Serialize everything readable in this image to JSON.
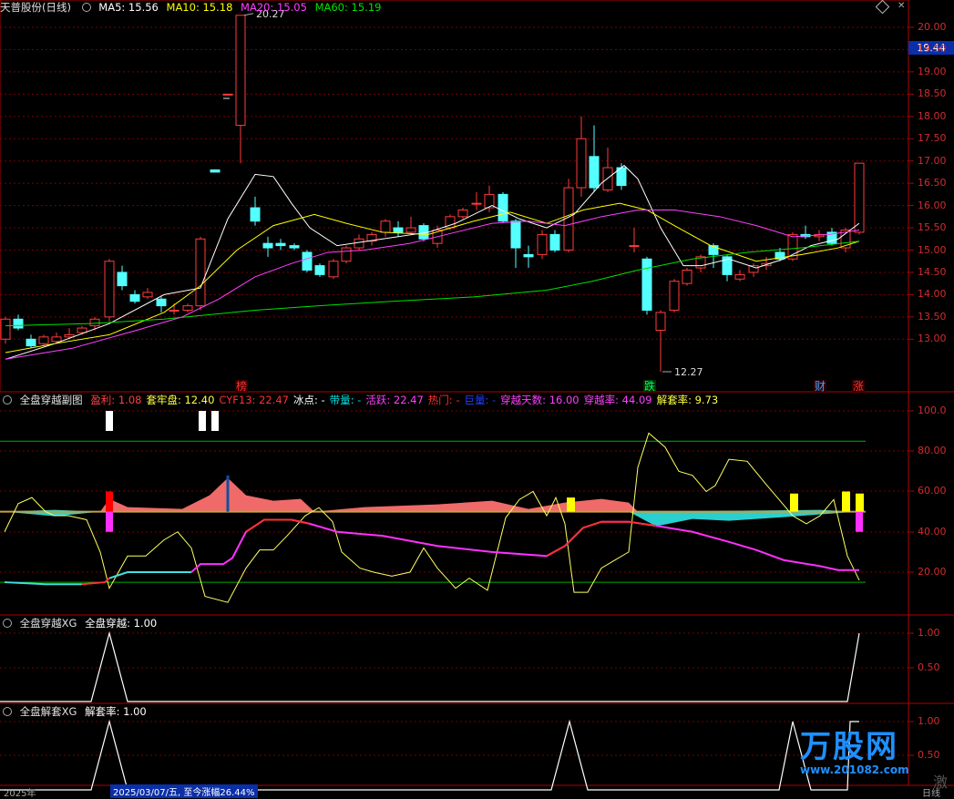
{
  "header_main": {
    "stock": "天普股份(日线)",
    "ma5": "MA5: 15.56",
    "ma10": "MA10: 15.18",
    "ma20": "MA20: 15.05",
    "ma60": "MA60: 15.19"
  },
  "header_sub": {
    "name": "全盘穿越副图",
    "items": [
      {
        "text": "盈利: 1.08",
        "color": "#ff4040"
      },
      {
        "text": "套牢盘: 12.40",
        "color": "#ffff40"
      },
      {
        "text": "CYF13: 22.47",
        "color": "#ff3030"
      },
      {
        "text": "冰点: -",
        "color": "#ffffff"
      },
      {
        "text": "带量: -",
        "color": "#00e5e5"
      },
      {
        "text": "活跃: 22.47",
        "color": "#ff40ff"
      },
      {
        "text": "热门: -",
        "color": "#ff3030"
      },
      {
        "text": "巨量: -",
        "color": "#2040ff"
      },
      {
        "text": "穿越天数: 16.00",
        "color": "#ff40ff"
      },
      {
        "text": "穿越率: 44.09",
        "color": "#ff40ff"
      },
      {
        "text": "解套率: 9.73",
        "color": "#ffff40"
      }
    ]
  },
  "header_xg1": {
    "name": "全盘穿越XG",
    "label": "全盘穿越: 1.00"
  },
  "header_xg2": {
    "name": "全盘解套XG",
    "label": "解套率: 1.00"
  },
  "price_axis": [
    "20.00",
    "19.50",
    "19.00",
    "18.50",
    "18.00",
    "17.50",
    "17.00",
    "16.50",
    "16.00",
    "15.50",
    "15.00",
    "14.50",
    "14.00",
    "13.50",
    "13.00"
  ],
  "current_price": "19.44",
  "sub_axis": [
    "100.0",
    "80.00",
    "60.00",
    "40.00",
    "20.00"
  ],
  "xg_axis": [
    "1.00",
    "0.50"
  ],
  "annotations": {
    "high": "20.27",
    "low": "12.27"
  },
  "tags": [
    {
      "text": "榜",
      "color": "#ff3030"
    },
    {
      "text": "跌",
      "color": "#00ff60"
    },
    {
      "text": "财",
      "color": "#40a0ff"
    },
    {
      "text": "涨",
      "color": "#ff3030"
    }
  ],
  "bottom": {
    "year": "2025年",
    "info": "2025/03/07/五, 至今涨幅26.44%",
    "mode": "日线"
  },
  "watermark": {
    "brand": "万股网",
    "url": "www.201082.com",
    "extra": "激"
  },
  "colors": {
    "up": "#ff3c3c",
    "down": "#54ffff",
    "ma5": "#ffffff",
    "ma10": "#ffff00",
    "ma20": "#ff40ff",
    "ma60": "#00e000",
    "grid": "#7a0000",
    "border": "#b00000"
  }
}
